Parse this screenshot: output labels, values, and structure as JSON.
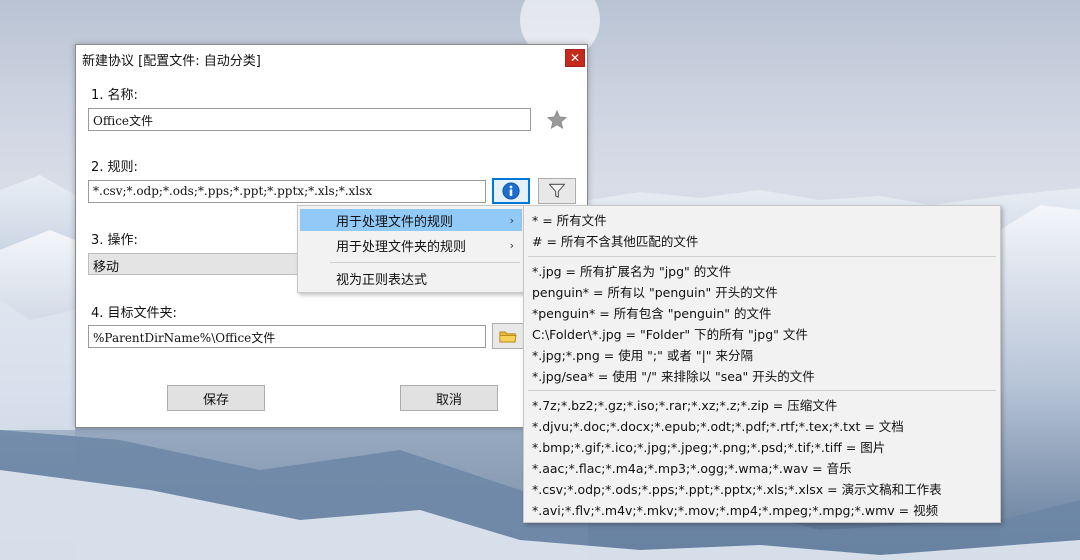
{
  "dialog": {
    "title": "新建协议 [配置文件: 自动分类]",
    "close_glyph": "✕",
    "name_label": "1. 名称:",
    "name_value": "Office文件",
    "rules_label": "2. 规则:",
    "rules_value": "*.csv;*.odp;*.ods;*.pps;*.ppt;*.pptx;*.xls;*.xlsx",
    "action_label": "3. 操作:",
    "action_value": "移动",
    "target_label": "4. 目标文件夹:",
    "target_value": "%ParentDirName%\\Office文件",
    "save_label": "保存",
    "cancel_label": "取消"
  },
  "icons": {
    "favorite": "star-icon",
    "info": "info-icon",
    "filter": "filter-icon",
    "folder": "folder-icon"
  },
  "menu": {
    "items": [
      {
        "label": "用于处理文件的规则",
        "has_submenu": true,
        "highlighted": true
      },
      {
        "label": "用于处理文件夹的规则",
        "has_submenu": true,
        "highlighted": false
      },
      {
        "label": "视为正则表达式",
        "has_submenu": false,
        "highlighted": false
      }
    ],
    "arrow_glyph": "›"
  },
  "submenu": {
    "group1": [
      "* = 所有文件",
      "# = 所有不含其他匹配的文件"
    ],
    "group2": [
      "*.jpg = 所有扩展名为 \"jpg\" 的文件",
      "penguin* = 所有以 \"penguin\" 开头的文件",
      "*penguin* = 所有包含 \"penguin\" 的文件",
      "C:\\Folder\\*.jpg = \"Folder\" 下的所有 \"jpg\" 文件",
      "*.jpg;*.png = 使用 \";\" 或者 \"|\" 来分隔",
      "*.jpg/sea* = 使用 \"/\" 来排除以 \"sea\" 开头的文件"
    ],
    "group3": [
      "*.7z;*.bz2;*.gz;*.iso;*.rar;*.xz;*.z;*.zip = 压缩文件",
      "*.djvu;*.doc;*.docx;*.epub;*.odt;*.pdf;*.rtf;*.tex;*.txt = 文档",
      "*.bmp;*.gif;*.ico;*.jpg;*.jpeg;*.png;*.psd;*.tif;*.tiff = 图片",
      "*.aac;*.flac;*.m4a;*.mp3;*.ogg;*.wma;*.wav = 音乐",
      "*.csv;*.odp;*.ods;*.pps;*.ppt;*.pptx;*.xls;*.xlsx = 演示文稿和工作表",
      "*.avi;*.flv;*.m4v;*.mkv;*.mov;*.mp4;*.mpeg;*.mpg;*.wmv = 视频"
    ]
  },
  "colors": {
    "accent": "#0078d7",
    "menu_highlight": "#91c9f7",
    "close_red": "#c42b1c"
  }
}
